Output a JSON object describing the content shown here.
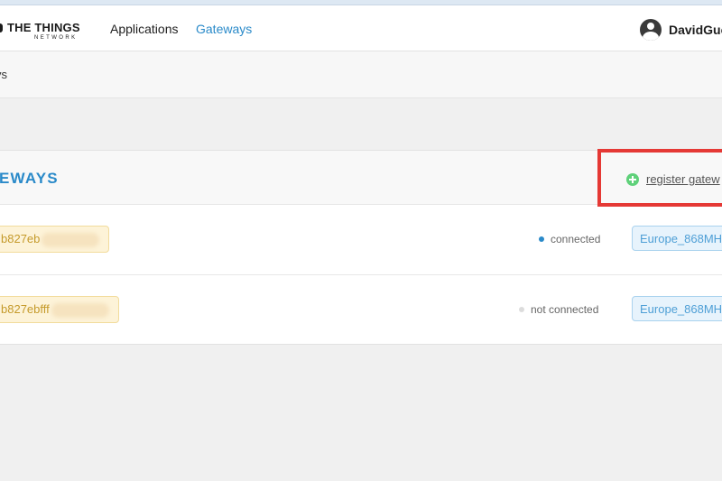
{
  "header": {
    "logo": {
      "line1": "THE THINGS",
      "line2": "NETWORK"
    },
    "nav": [
      {
        "label": "Applications"
      },
      {
        "label": "Gateways"
      }
    ],
    "user": {
      "name": "DavidGuc"
    }
  },
  "breadcrumb": {
    "text": "ys"
  },
  "panel": {
    "title": "EWAYS",
    "register_label": "register gatew"
  },
  "gateways": [
    {
      "id": "b827eb",
      "status": "connected",
      "status_color": "#2a8ac9",
      "frequency_plan": "Europe_868MH"
    },
    {
      "id": "b827ebfff",
      "status": "not connected",
      "status_color": "#dcdcdc",
      "frequency_plan": "Europe_868MH"
    }
  ],
  "colors": {
    "accent": "#2a8ac9",
    "highlight": "#e53935",
    "add": "#5fd17a"
  }
}
